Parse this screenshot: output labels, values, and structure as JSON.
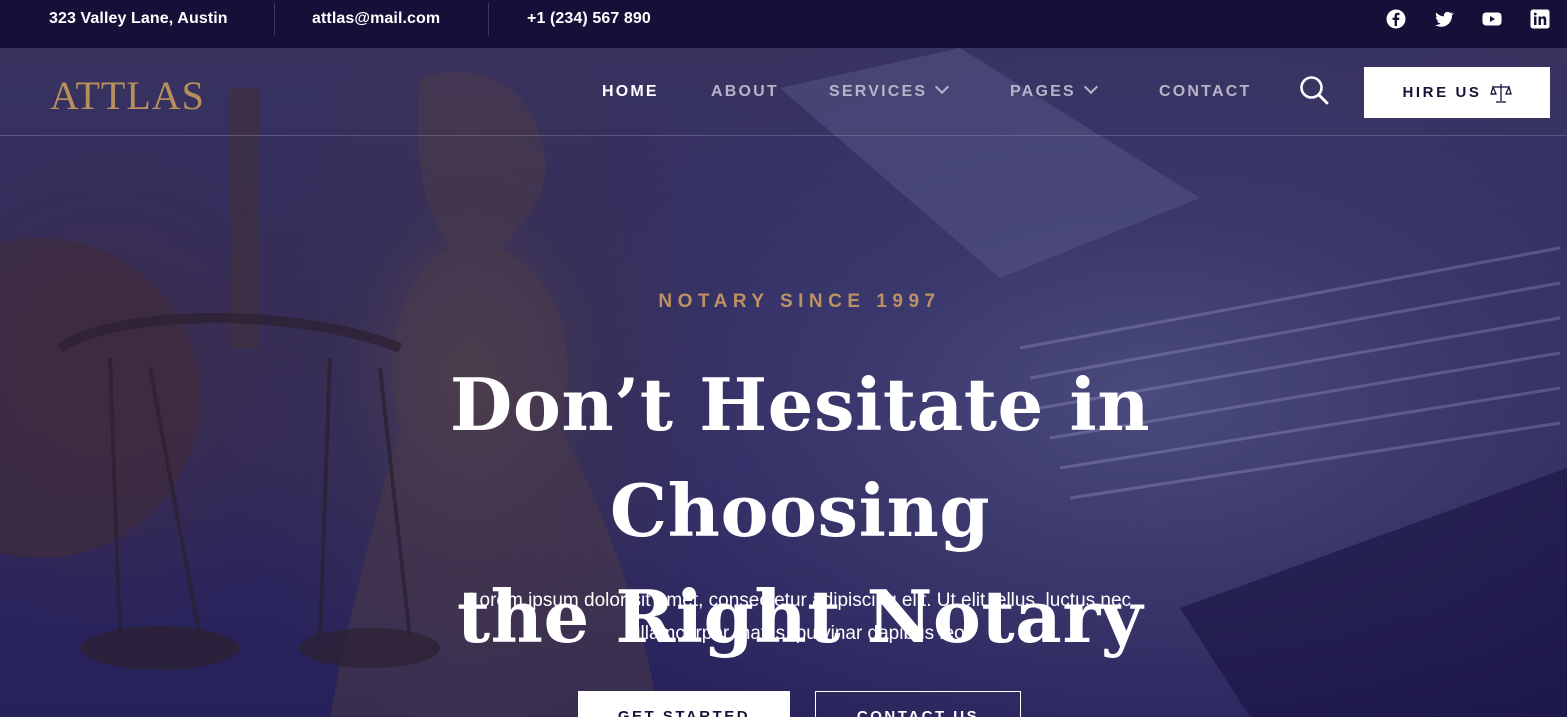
{
  "topbar": {
    "address": "323 Valley Lane, Austin",
    "email": "attlas@mail.com",
    "phone": "+1 (234) 567 890",
    "socials": [
      "facebook-icon",
      "twitter-icon",
      "youtube-icon",
      "linkedin-icon"
    ]
  },
  "nav": {
    "logo": "ATTLAS",
    "items": [
      {
        "label": "HOME",
        "active": true
      },
      {
        "label": "ABOUT"
      },
      {
        "label": "SERVICES",
        "dropdown": true
      },
      {
        "label": "PAGES",
        "dropdown": true
      },
      {
        "label": "CONTACT"
      }
    ],
    "search_icon": "search-icon",
    "cta_label": "HIRE US",
    "cta_icon": "scales-icon"
  },
  "hero": {
    "eyebrow": "NOTARY SINCE 1997",
    "headline_line1": "Don’t Hesitate in Choosing",
    "headline_line2": "the Right Notary",
    "description": "Lorem ipsum dolor sit amet, consectetur adipiscing elit. Ut elit tellus, luctus nec ullamcorper mattis, pulvinar dapibus leo.",
    "primary_button": "GET STARTED",
    "secondary_button": "CONTACT US"
  },
  "colors": {
    "accent_gold": "#bd9263",
    "topbar_bg": "#141038",
    "overlay": "#2e2962"
  }
}
